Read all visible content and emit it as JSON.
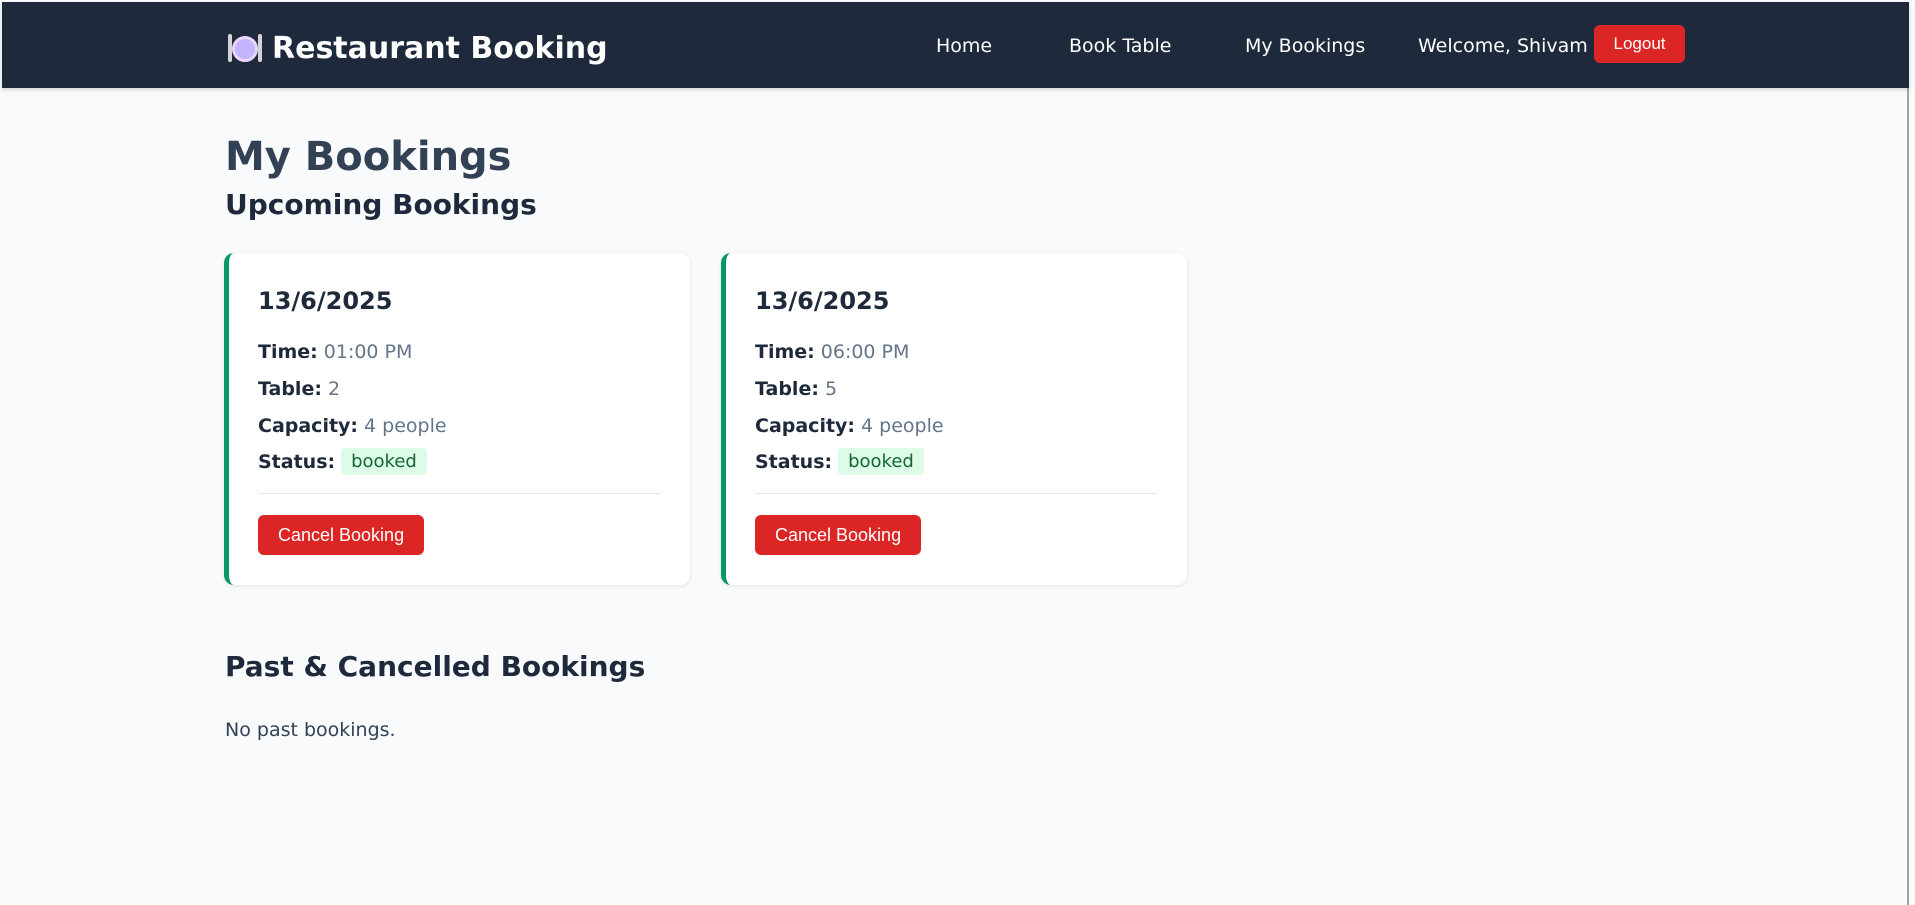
{
  "navbar": {
    "brand": "Restaurant Booking",
    "brand_icon": "plate-cutlery-icon",
    "links": [
      {
        "label": "Home"
      },
      {
        "label": "Book Table"
      },
      {
        "label": "My Bookings"
      }
    ],
    "welcome": "Welcome, Shivam",
    "logout_label": "Logout"
  },
  "page": {
    "title": "My Bookings",
    "upcoming_title": "Upcoming Bookings",
    "past_title": "Past & Cancelled Bookings",
    "past_empty": "No past bookings."
  },
  "bookings": [
    {
      "date": "13/6/2025",
      "time_label": "Time:",
      "time": "01:00 PM",
      "table_label": "Table:",
      "table": "2",
      "capacity_label": "Capacity:",
      "capacity": "4 people",
      "status_label": "Status:",
      "status": "booked",
      "cancel_label": "Cancel Booking"
    },
    {
      "date": "13/6/2025",
      "time_label": "Time:",
      "time": "06:00 PM",
      "table_label": "Table:",
      "table": "5",
      "capacity_label": "Capacity:",
      "capacity": "4 people",
      "status_label": "Status:",
      "status": "booked",
      "cancel_label": "Cancel Booking"
    }
  ],
  "colors": {
    "navbar": "#1e293b",
    "accent_danger": "#dc2626",
    "card_border": "#059669",
    "badge_bg": "#dcfce7",
    "badge_text": "#166534"
  }
}
